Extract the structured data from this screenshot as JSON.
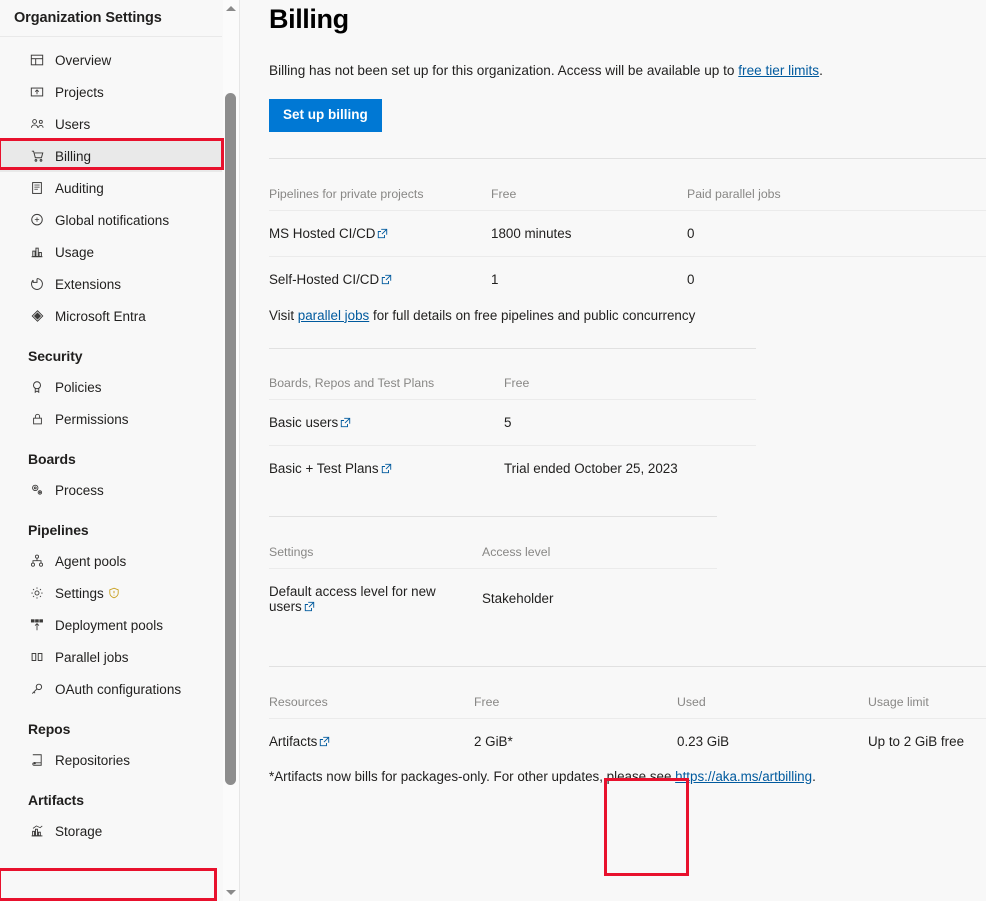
{
  "sidebar": {
    "title": "Organization Settings",
    "items": [
      {
        "label": "Overview",
        "icon": "overview-icon",
        "type": "item",
        "selected": false
      },
      {
        "label": "Projects",
        "icon": "projects-icon",
        "type": "item",
        "selected": false
      },
      {
        "label": "Users",
        "icon": "users-icon",
        "type": "item",
        "selected": false
      },
      {
        "label": "Billing",
        "icon": "billing-cart-icon",
        "type": "item",
        "selected": true
      },
      {
        "label": "Auditing",
        "icon": "auditing-icon",
        "type": "item",
        "selected": false
      },
      {
        "label": "Global notifications",
        "icon": "notifications-icon",
        "type": "item",
        "selected": false
      },
      {
        "label": "Usage",
        "icon": "usage-chart-icon",
        "type": "item",
        "selected": false
      },
      {
        "label": "Extensions",
        "icon": "extensions-icon",
        "type": "item",
        "selected": false
      },
      {
        "label": "Microsoft Entra",
        "icon": "entra-icon",
        "type": "item",
        "selected": false
      },
      {
        "label": "Security",
        "type": "group"
      },
      {
        "label": "Policies",
        "icon": "policies-ribbon-icon",
        "type": "item",
        "selected": false
      },
      {
        "label": "Permissions",
        "icon": "lock-icon",
        "type": "item",
        "selected": false
      },
      {
        "label": "Boards",
        "type": "group"
      },
      {
        "label": "Process",
        "icon": "process-icon",
        "type": "item",
        "selected": false
      },
      {
        "label": "Pipelines",
        "type": "group"
      },
      {
        "label": "Agent pools",
        "icon": "agent-pools-icon",
        "type": "item",
        "selected": false
      },
      {
        "label": "Settings",
        "icon": "gear-icon",
        "type": "item",
        "selected": false,
        "warning": true
      },
      {
        "label": "Deployment pools",
        "icon": "deployment-pools-icon",
        "type": "item",
        "selected": false
      },
      {
        "label": "Parallel jobs",
        "icon": "parallel-jobs-icon",
        "type": "item",
        "selected": false
      },
      {
        "label": "OAuth configurations",
        "icon": "oauth-key-icon",
        "type": "item",
        "selected": false
      },
      {
        "label": "Repos",
        "type": "group"
      },
      {
        "label": "Repositories",
        "icon": "repositories-icon",
        "type": "item",
        "selected": false
      },
      {
        "label": "Artifacts",
        "type": "group"
      },
      {
        "label": "Storage",
        "icon": "storage-chart-icon",
        "type": "item",
        "selected": false
      }
    ]
  },
  "main": {
    "title": "Billing",
    "intro_prefix": "Billing has not been set up for this organization. Access will be available up to ",
    "intro_link": "free tier limits",
    "intro_suffix": ".",
    "setup_button": "Set up billing",
    "pipelines_table": {
      "headers": [
        "Pipelines for private projects",
        "Free",
        "Paid parallel jobs"
      ],
      "rows": [
        [
          "MS Hosted CI/CD",
          "1800 minutes",
          "0"
        ],
        [
          "Self-Hosted CI/CD",
          "1",
          "0"
        ]
      ],
      "footnote_prefix": "Visit ",
      "footnote_link": "parallel jobs",
      "footnote_suffix": " for full details on free pipelines and public concurrency"
    },
    "boards_table": {
      "headers": [
        "Boards, Repos and Test Plans",
        "Free"
      ],
      "rows": [
        [
          "Basic users",
          "5"
        ],
        [
          "Basic + Test Plans",
          "Trial ended October 25, 2023"
        ]
      ]
    },
    "settings_table": {
      "headers": [
        "Settings",
        "Access level"
      ],
      "rows": [
        [
          "Default access level for new users",
          "Stakeholder"
        ]
      ]
    },
    "resources_table": {
      "headers": [
        "Resources",
        "Free",
        "Used",
        "Usage limit"
      ],
      "rows": [
        [
          "Artifacts",
          "2 GiB*",
          "0.23 GiB",
          "Up to 2 GiB free"
        ]
      ],
      "footnote_prefix": "*Artifacts now bills for packages-only. For other updates, please see ",
      "footnote_link": "https://aka.ms/artbilling",
      "footnote_suffix": "."
    }
  },
  "annotations": {
    "highlight_color": "#e8112d",
    "boxes": [
      "billing-nav-highlight",
      "storage-nav-highlight",
      "used-column-highlight"
    ]
  },
  "colors": {
    "accent": "#0078d4",
    "link": "#005a9e",
    "selected_bg": "#e9e9e9",
    "page_bg": "#f8f8f8",
    "divider": "#e1e1e1"
  }
}
